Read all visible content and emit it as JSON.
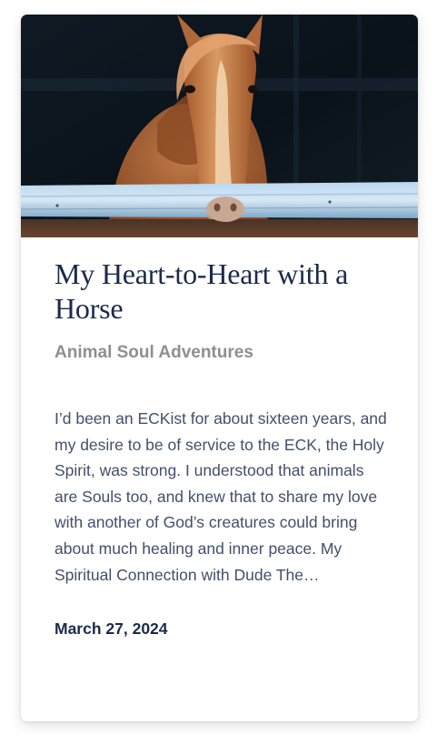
{
  "card": {
    "image_subject": "horse-photo",
    "title": "My Heart-to-Heart with a Horse",
    "category": "Animal Soul Adventures",
    "excerpt": "I’d been an ECKist for about sixteen years, and my desire to be of service to the ECK, the Holy Spirit, was strong. I understood that animals are Souls too, and knew that to share my love with another of God’s creatures could bring about much healing and inner peace. My Spiritual Connection with Dude The…",
    "date": "March 27, 2024"
  },
  "colors": {
    "title": "#1b2a4a",
    "category": "#8f8f8f",
    "excerpt": "#43506a",
    "date": "#1b2a4a",
    "card_background": "#ffffff"
  }
}
